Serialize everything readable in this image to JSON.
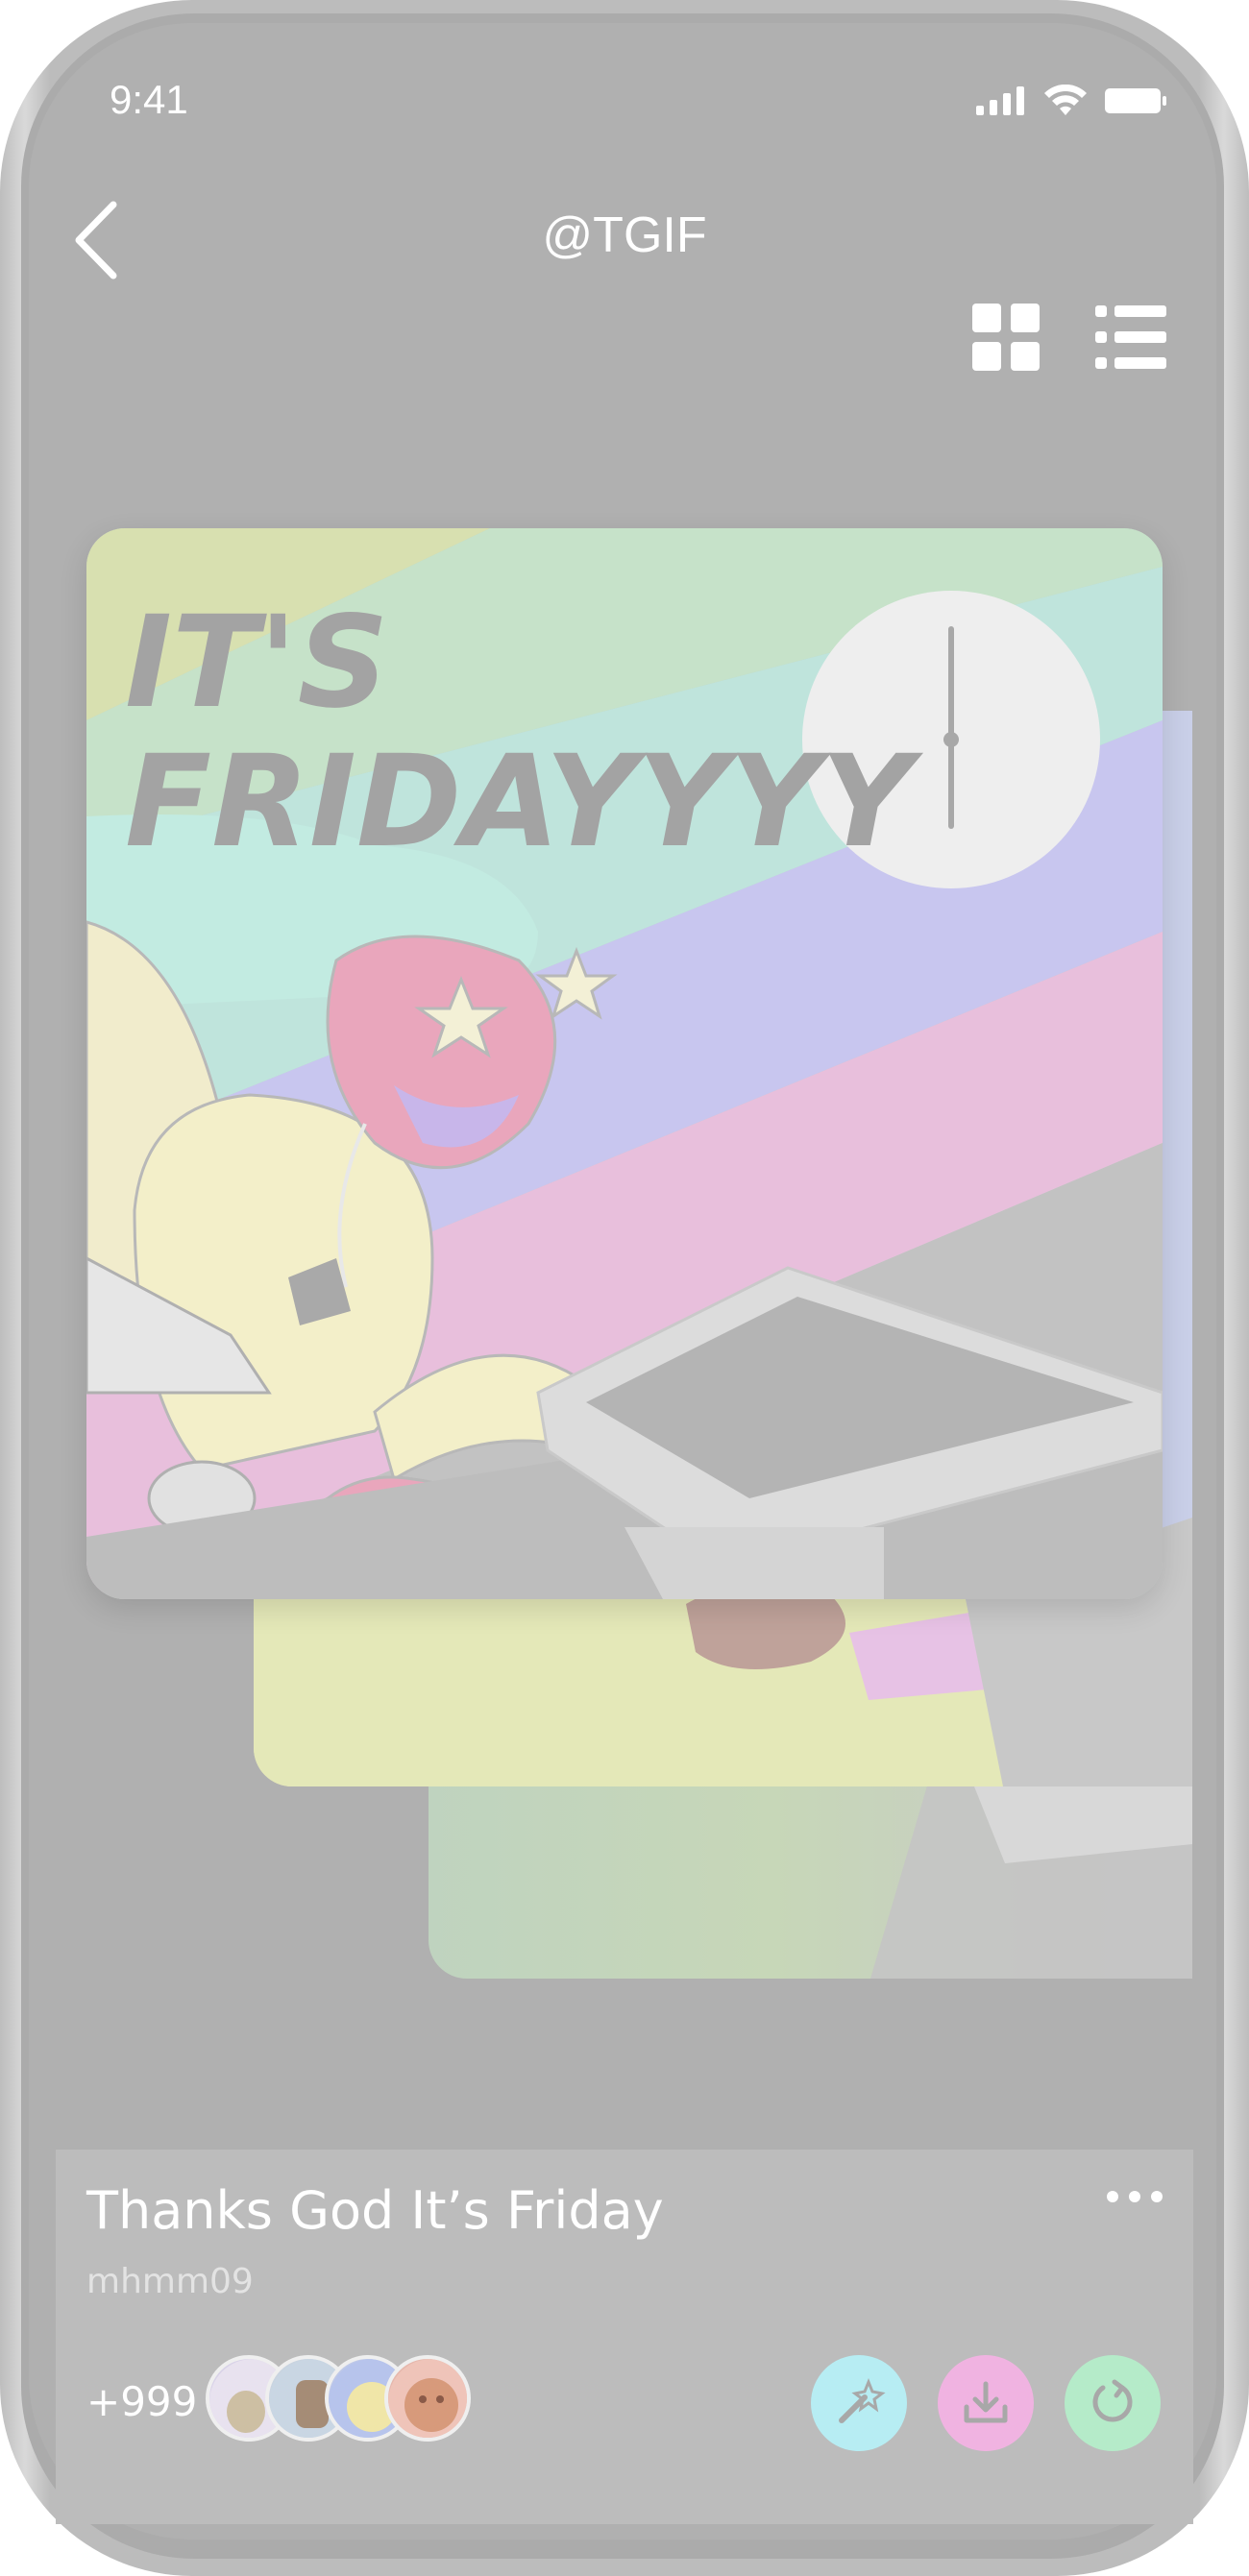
{
  "status_bar": {
    "time": "9:41"
  },
  "header": {
    "title": "@TGIF"
  },
  "artwork": {
    "headline_line1": "IT'S",
    "headline_line2": "FRIDAYYYY"
  },
  "track": {
    "title": "Thanks God It’s Friday",
    "artist": "mhmm09",
    "listener_count": "+999"
  },
  "icons": {
    "back": "chevron-left-icon",
    "grid": "grid-view-icon",
    "list": "list-view-icon",
    "more": "more-horizontal-icon",
    "magic": "magic-wand-icon",
    "download": "download-icon",
    "refresh": "refresh-icon"
  },
  "colors": {
    "magic_button": "#b7edf3",
    "download_button": "#f0b3e1",
    "refresh_button": "#b5ebc9"
  }
}
